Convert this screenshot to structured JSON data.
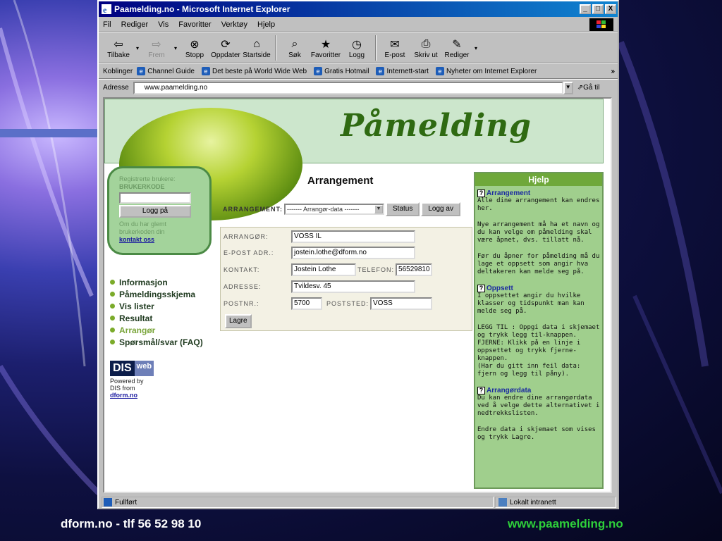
{
  "colors": {
    "title_bar": "#000080",
    "help_header": "#6fa83b",
    "logo_text": "#2f6a12",
    "footer_right": "#2ed03a"
  },
  "window": {
    "title": "Paamelding.no - Microsoft Internet Explorer",
    "min": "_",
    "max": "□",
    "close": "X"
  },
  "menu": [
    "Fil",
    "Rediger",
    "Vis",
    "Favoritter",
    "Verktøy",
    "Hjelp"
  ],
  "toolbar": [
    {
      "label": "Tilbake",
      "icon": "back-arrow-icon"
    },
    {
      "label": "Frem",
      "icon": "forward-arrow-icon"
    },
    {
      "label": "Stopp",
      "icon": "stop-icon"
    },
    {
      "label": "Oppdater",
      "icon": "refresh-icon"
    },
    {
      "label": "Startside",
      "icon": "home-icon"
    },
    {
      "label": "Søk",
      "icon": "search-icon"
    },
    {
      "label": "Favoritter",
      "icon": "favorites-icon"
    },
    {
      "label": "Logg",
      "icon": "history-icon"
    },
    {
      "label": "E-post",
      "icon": "mail-icon"
    },
    {
      "label": "Skriv ut",
      "icon": "print-icon"
    },
    {
      "label": "Rediger",
      "icon": "edit-icon"
    }
  ],
  "links": {
    "label": "Koblinger",
    "items": [
      "Channel Guide",
      "Det beste på World Wide Web",
      "Gratis Hotmail",
      "Internett-start",
      "Nyheter om Internet Explorer"
    ],
    "more": "»"
  },
  "address": {
    "label": "Adresse",
    "url": "www.paamelding.no",
    "go": "Gå til"
  },
  "page": {
    "logo": "Påmelding",
    "login": {
      "label1": "Registrerte brukere:",
      "label2": "BRUKERKODE",
      "button": "Logg på",
      "forgot": "Om du har glemt brukerkoden din",
      "contact": "kontakt oss"
    },
    "nav": [
      "Informasjon",
      "Påmeldingsskjema",
      "Vis lister",
      "Resultat",
      "Arrangør",
      "Spørsmål/svar (FAQ)"
    ],
    "dis": {
      "mark1": "DIS",
      "mark2": "web",
      "line1": "Powered by",
      "line2": "DIS from",
      "link": "dform.no"
    },
    "section_title": "Arrangement",
    "arrangement": {
      "label": "ARRANGEMENT:",
      "selected": "------- Arrangør-data -------",
      "status_btn": "Status",
      "logout_btn": "Logg av"
    },
    "form": {
      "organizer_label": "ARRANGØR:",
      "organizer": "VOSS IL",
      "email_label": "E-POST ADR.:",
      "email": "jostein.lothe@dform.no",
      "contact_label": "KONTAKT:",
      "contact": "Jostein Lothe",
      "phone_label": "TELEFON:",
      "phone": "56529810",
      "address_label": "ADRESSE:",
      "address": "Tvildesv. 45",
      "zip_label": "POSTNR.:",
      "zip": "5700",
      "city_label": "POSTSTED:",
      "city": "VOSS",
      "save": "Lagre"
    },
    "help": {
      "title": "Hjelp",
      "sections": [
        {
          "title": "Arrangement",
          "body": [
            "Alle dine arrangement kan endres her.",
            "Nye arrangement må ha et navn og du kan velge om påmelding skal være åpnet, dvs. tillatt nå.",
            "Før du åpner for påmelding må du lage et oppsett som angir hva deltakeren kan melde seg på."
          ]
        },
        {
          "title": "Oppsett",
          "body": [
            "I oppsettet angir du hvilke klasser og tidspunkt man kan melde seg på.",
            "LEGG TIL : Oppgi data i skjemaet og trykk legg til-knappen.\nFJERNE: Klikk på en linje i oppsettet og trykk fjerne-knappen.\n(Har du gitt inn feil data: fjern og legg til påny)."
          ]
        },
        {
          "title": "Arrangørdata",
          "body": [
            "Du kan endre dine arrangørdata ved å velge dette alternativet i nedtrekkslisten.",
            "Endre data i skjemaet som vises og trykk Lagre."
          ]
        }
      ]
    }
  },
  "status": {
    "text": "Fullført",
    "zone": "Lokalt intranett"
  },
  "footer": {
    "left": "dform.no - tlf 56 52 98 10",
    "right": "www.paamelding.no"
  }
}
